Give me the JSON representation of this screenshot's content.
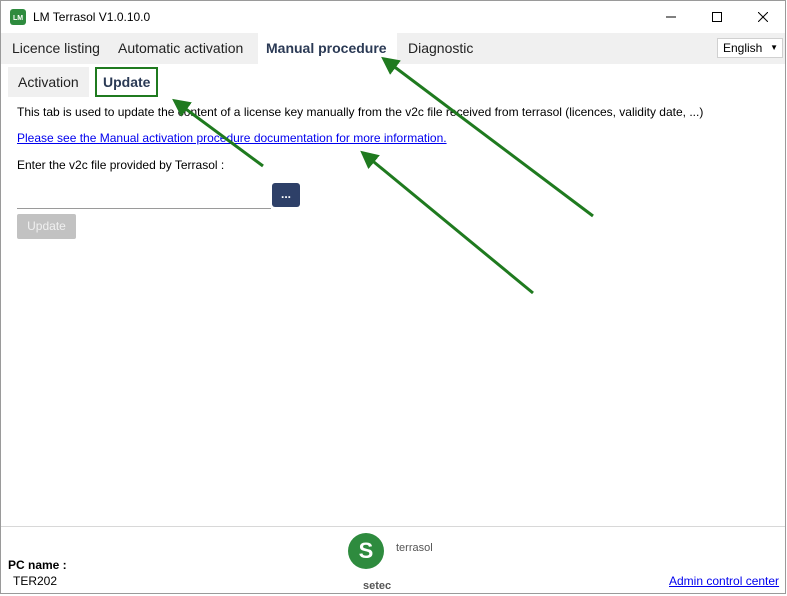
{
  "window": {
    "title": "LM Terrasol V1.0.10.0"
  },
  "tabs": [
    {
      "label": "Licence listing"
    },
    {
      "label": "Automatic activation"
    },
    {
      "label": "Manual procedure"
    },
    {
      "label": "Diagnostic"
    }
  ],
  "language": {
    "selected": "English"
  },
  "subtabs": [
    {
      "label": "Activation"
    },
    {
      "label": "Update"
    }
  ],
  "content": {
    "description": "This tab is used to update the content of a license key manually from the v2c file received from terrasol (licences, validity date, ...)",
    "doc_link": "Please see the Manual activation procedure documentation for more information.",
    "file_label": "Enter the v2c file provided by Terrasol :",
    "file_value": "",
    "browse_label": "...",
    "update_label": "Update"
  },
  "footer": {
    "pc_label": "PC name :",
    "pc_value": "TER202",
    "logo_top": "terrasol",
    "logo_bottom": "setec",
    "admin_link": "Admin control center"
  },
  "colors": {
    "annotation": "#1f7a1f",
    "primary_button": "#2e4068",
    "link": "#0000ee",
    "logo_green": "#2e8b3e"
  }
}
